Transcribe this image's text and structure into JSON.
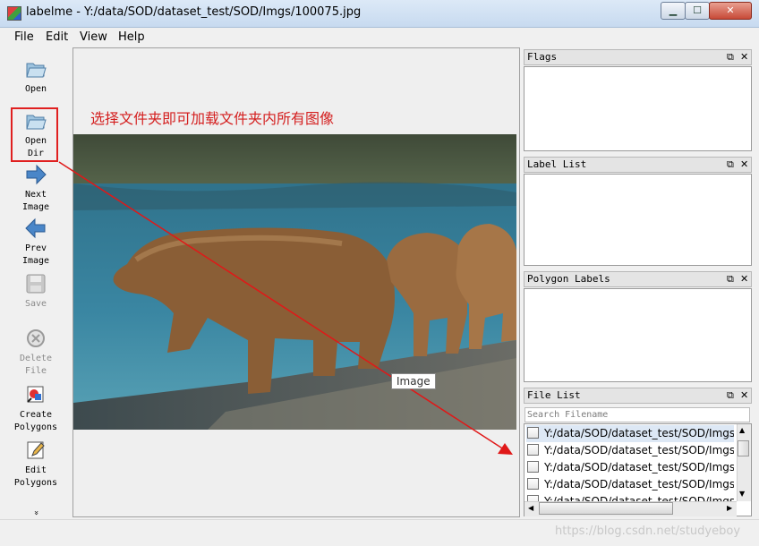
{
  "window": {
    "title": "labelme - Y:/data/SOD/dataset_test/SOD/Imgs/100075.jpg",
    "controls": {
      "minimize": "▁",
      "maximize": "☐",
      "close": "✕"
    }
  },
  "menu": [
    "File",
    "Edit",
    "View",
    "Help"
  ],
  "toolbar": [
    {
      "label": "Open",
      "icon": "folder-open-icon",
      "enabled": true
    },
    {
      "label": "Open\nDir",
      "icon": "folder-open-icon",
      "enabled": true
    },
    {
      "label": "Next\nImage",
      "icon": "arrow-right-icon",
      "enabled": true
    },
    {
      "label": "Prev\nImage",
      "icon": "arrow-left-icon",
      "enabled": true
    },
    {
      "label": "Save",
      "icon": "floppy-disk-icon",
      "enabled": false
    },
    {
      "label": "Delete\nFile",
      "icon": "delete-circle-icon",
      "enabled": false
    },
    {
      "label": "Create\nPolygons",
      "icon": "create-polygon-icon",
      "enabled": true
    },
    {
      "label": "Edit\nPolygons",
      "icon": "edit-pencil-icon",
      "enabled": true
    },
    {
      "label": "»",
      "icon": "chevron-more-icon",
      "enabled": true
    }
  ],
  "canvas": {
    "annotation": "选择文件夹即可加载文件夹内所有图像",
    "tooltip": "Image"
  },
  "docks": {
    "flags": "Flags",
    "label_list": "Label List",
    "polygon_labels": "Polygon Labels",
    "file_list": "File List"
  },
  "file_list": {
    "search_placeholder": "Search Filename",
    "items": [
      "Y:/data/SOD/dataset_test/SOD/Imgs\\",
      "Y:/data/SOD/dataset_test/SOD/Imgs\\",
      "Y:/data/SOD/dataset_test/SOD/Imgs\\",
      "Y:/data/SOD/dataset_test/SOD/Imgs\\",
      "Y:/data/SOD/dataset_test/SOD/Imgs\\"
    ]
  },
  "watermark": "https://blog.csdn.net/studyeboy",
  "colors": {
    "annotation_red": "#d42020",
    "title_bar": "#c7daf0"
  }
}
